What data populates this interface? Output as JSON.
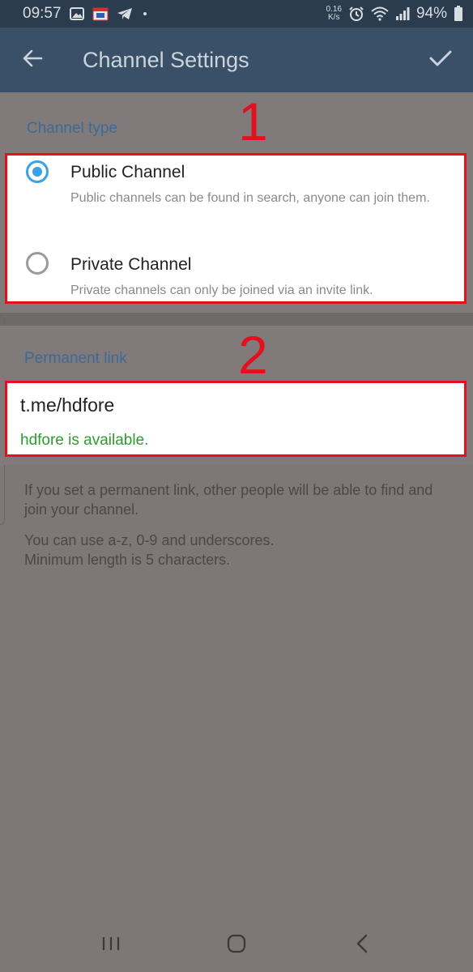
{
  "status_bar": {
    "time": "09:57",
    "net_speed_value": "0.16",
    "net_speed_unit": "K/s",
    "battery": "94%",
    "icons": [
      "image-icon",
      "calendar-icon",
      "telegram-icon",
      "dot-icon",
      "alarm-icon",
      "wifi-icon",
      "signal-icon",
      "battery-icon"
    ]
  },
  "toolbar": {
    "title": "Channel Settings",
    "back_icon": "arrow-back-icon",
    "done_icon": "check-icon"
  },
  "channel_type": {
    "header": "Channel type",
    "annotation": "1",
    "options": [
      {
        "title": "Public Channel",
        "description": "Public channels can be found in search, anyone can join them.",
        "selected": true
      },
      {
        "title": "Private Channel",
        "description": "Private channels can only be joined via an invite link.",
        "selected": false
      }
    ]
  },
  "permanent_link": {
    "header": "Permanent link",
    "annotation": "2",
    "value": "t.me/hdfore",
    "status": "hdfore is available."
  },
  "info": {
    "paragraph1": "If you set a permanent link, other people will be able to find and join your channel.",
    "paragraph2_line1": "You can use a-z, 0-9 and underscores.",
    "paragraph2_line2": "Minimum length is 5 characters."
  },
  "colors": {
    "accent": "#3aa1e6",
    "highlight_border": "#e3101d",
    "available_green": "#2e9b2e",
    "toolbar": "#3a5068"
  }
}
